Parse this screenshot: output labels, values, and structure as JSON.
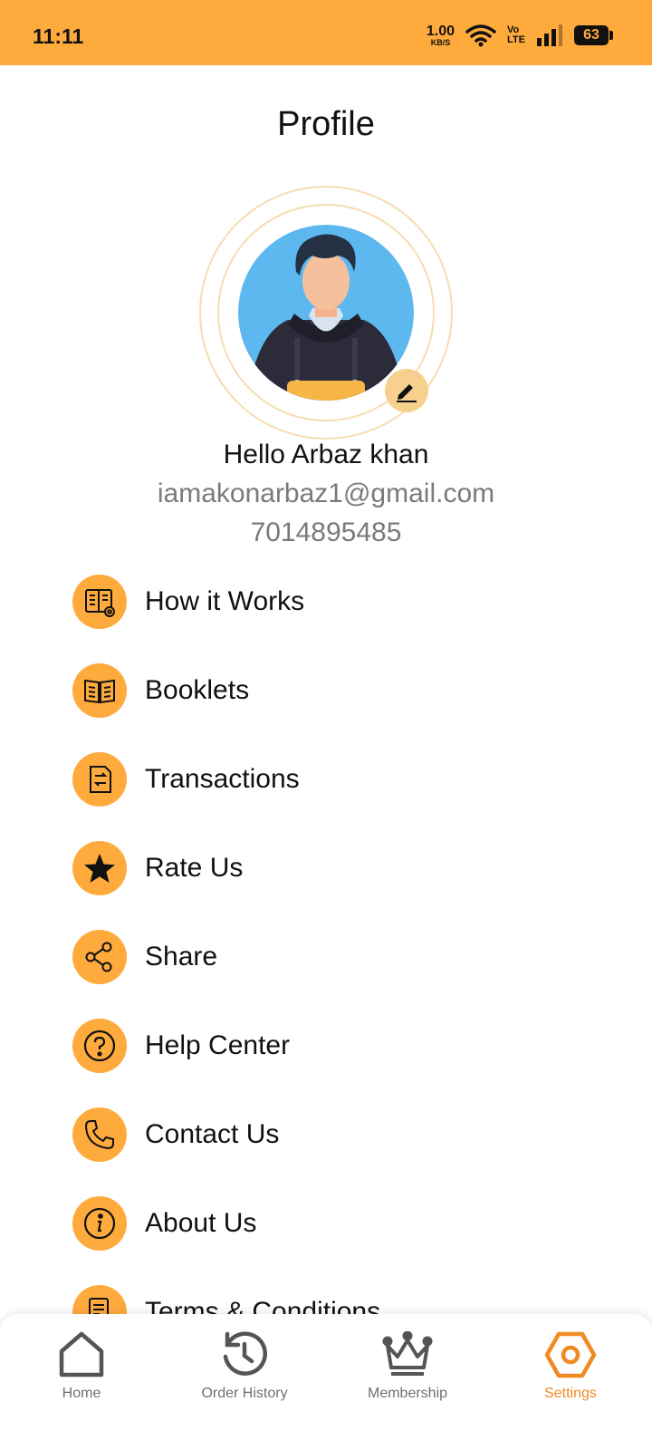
{
  "status_bar": {
    "time": "11:11",
    "net_speed_value": "1.00",
    "net_speed_unit": "KB/S",
    "volte_top": "Vo",
    "volte_bottom": "LTE",
    "battery": "63"
  },
  "header": {
    "title": "Profile"
  },
  "profile": {
    "greeting": "Hello Arbaz khan",
    "email": "iamakonarbaz1@gmail.com",
    "phone": "7014895485"
  },
  "menu": {
    "items": [
      {
        "label": "How it Works",
        "icon": "book-gear-icon"
      },
      {
        "label": "Booklets",
        "icon": "open-book-icon"
      },
      {
        "label": "Transactions",
        "icon": "receipt-icon"
      },
      {
        "label": "Rate Us",
        "icon": "star-icon"
      },
      {
        "label": "Share",
        "icon": "share-icon"
      },
      {
        "label": "Help Center",
        "icon": "question-icon"
      },
      {
        "label": "Contact Us",
        "icon": "phone-icon"
      },
      {
        "label": "About Us",
        "icon": "info-icon"
      },
      {
        "label": "Terms & Conditions",
        "icon": "document-check-icon"
      }
    ]
  },
  "bottom_nav": {
    "items": [
      {
        "label": "Home",
        "icon": "home-icon"
      },
      {
        "label": "Order History",
        "icon": "history-icon"
      },
      {
        "label": "Membership",
        "icon": "crown-icon"
      },
      {
        "label": "Settings",
        "icon": "settings-icon",
        "active": true
      }
    ]
  },
  "colors": {
    "accent": "#FFAA3D",
    "active_nav": "#F08A24",
    "muted_text": "#7a7a7a"
  }
}
